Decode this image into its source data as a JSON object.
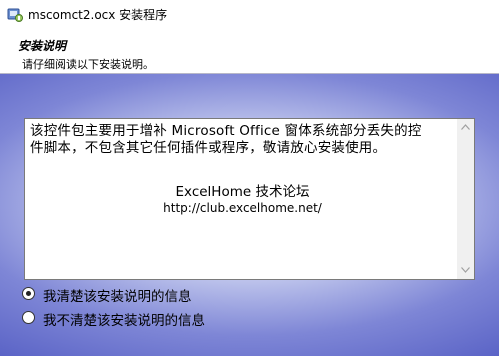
{
  "window": {
    "title": "mscomct2.ocx 安装程序",
    "icon": "setup-icon"
  },
  "header": {
    "title": "安装说明",
    "subtitle": "请仔细阅读以下安装说明。"
  },
  "notes": {
    "line1": "该控件包主要用于增补 Microsoft Office 窗体系统部分丢失的控",
    "line2": "件脚本，不包含其它任何插件或程序，敬请放心安装使用。",
    "signature": "ExcelHome 技术论坛",
    "url": "http://club.excelhome.net/"
  },
  "options": [
    {
      "label": "我清楚该安装说明的信息",
      "selected": true
    },
    {
      "label": "我不清楚该安装说明的信息",
      "selected": false
    }
  ],
  "colors": {
    "background_edge": "#4c55bd",
    "background_center": "#eef0fb"
  }
}
